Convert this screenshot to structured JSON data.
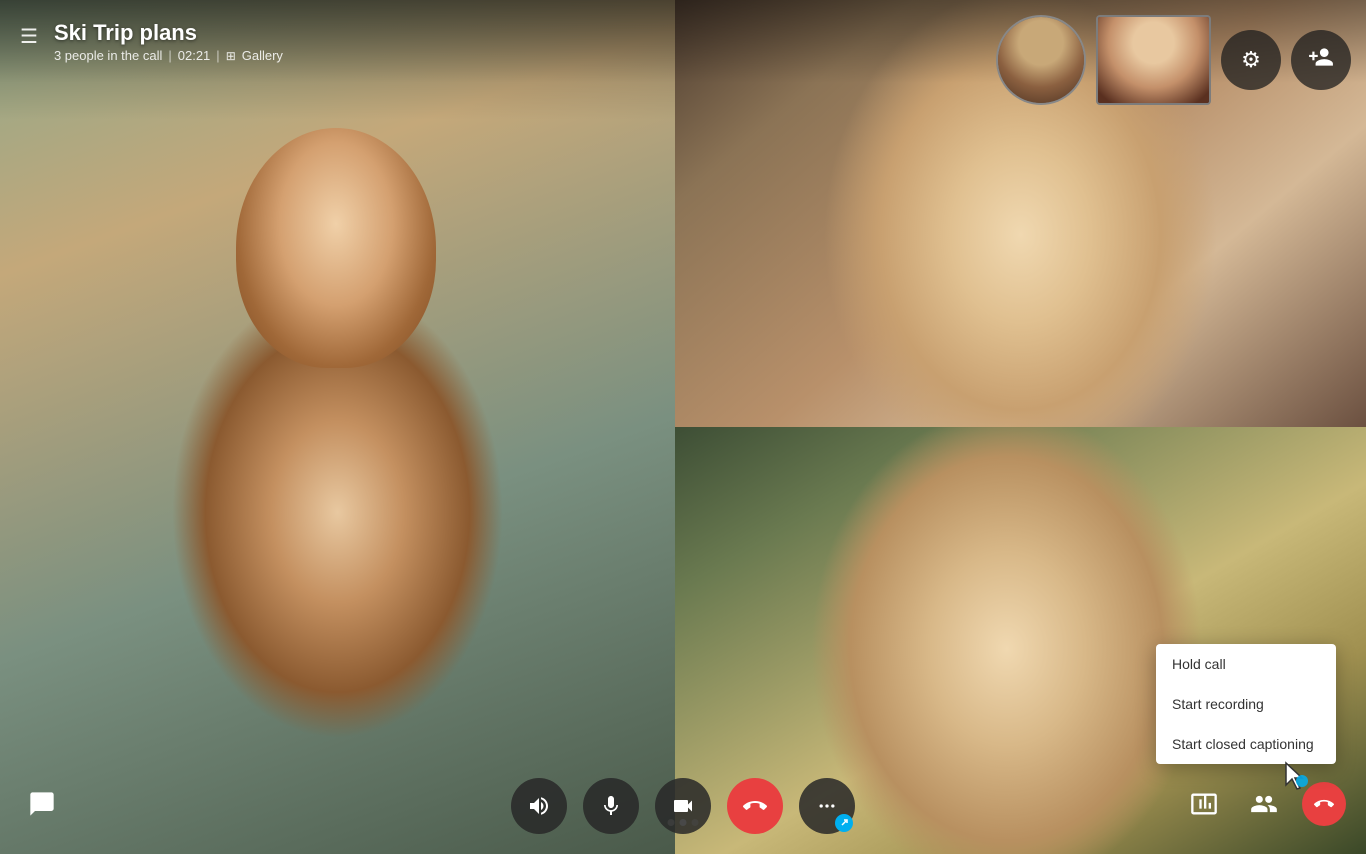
{
  "header": {
    "title": "Ski Trip plans",
    "participants": "3 people in the call",
    "duration": "02:21",
    "view_mode": "Gallery"
  },
  "controls": {
    "volume_label": "🔊",
    "mute_label": "🎤",
    "camera_label": "📷",
    "end_call_label": "📞",
    "more_label": "•••",
    "chat_label": "💬",
    "screen_share_label": "⬛",
    "participants_label": "👤+"
  },
  "top_controls": {
    "settings_label": "⚙",
    "add_person_label": "👤+"
  },
  "context_menu": {
    "items": [
      {
        "label": "Hold call"
      },
      {
        "label": "Start recording"
      },
      {
        "label": "Start closed captioning"
      }
    ]
  },
  "gallery_dots": [
    {
      "active": false
    },
    {
      "active": true
    },
    {
      "active": false
    }
  ]
}
